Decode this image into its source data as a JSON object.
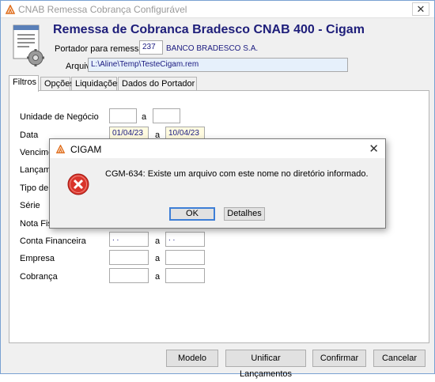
{
  "window": {
    "title": "CNAB Remessa Cobrança Configurável",
    "close_glyph": "✕"
  },
  "header": {
    "title": "Remessa de Cobranca Bradesco CNAB 400 - Cigam",
    "portador_label": "Portador para remessa",
    "portador_code": "237",
    "portador_name": "BANCO BRADESCO S.A.",
    "arquivo_label": "Arquivo",
    "arquivo_value": "L:\\Aline\\Temp\\TesteCigam.rem"
  },
  "tabs": [
    {
      "label": "Filtros",
      "active": true
    },
    {
      "label": "Opções",
      "active": false
    },
    {
      "label": "Liquidações",
      "active": false
    },
    {
      "label": "Dados do Portador",
      "active": false
    }
  ],
  "filters": {
    "unidade_label": "Unidade de Negócio",
    "data_label": "Data",
    "data_from": "01/04/23",
    "data_to": "10/04/23",
    "vencimento_label": "Vencimen",
    "lancamento_label": "Lançame",
    "tipo_label": "Tipo de F",
    "serie_label": "Série",
    "nota_label": "Nota Fisca",
    "conta_label": "Conta Financeira",
    "conta_from": " .  .",
    "conta_to": " .  .",
    "empresa_label": "Empresa",
    "cobranca_label": "Cobrança",
    "range_sep": "a"
  },
  "buttons": {
    "modelo": "Modelo",
    "unificar": "Unificar Lançamentos",
    "confirmar": "Confirmar",
    "cancelar": "Cancelar"
  },
  "dialog": {
    "title": "CIGAM",
    "message": "CGM-634: Existe um arquivo com este nome no diretório informado.",
    "ok_label": "OK",
    "detalhes_label": "Detalhes",
    "close_glyph": "✕"
  },
  "colors": {
    "title_blue": "#1e1e7a",
    "error_red": "#d9342b",
    "focus_blue": "#3d7ed6"
  }
}
